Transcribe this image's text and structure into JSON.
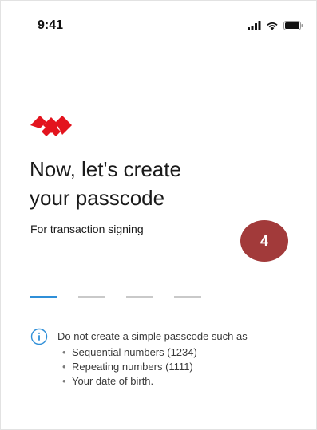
{
  "status_bar": {
    "time": "9:41"
  },
  "icons": {
    "signal": "cellular-signal-icon",
    "wifi": "wifi-icon",
    "battery": "battery-icon",
    "logo": "brand-diamond-logo",
    "info": "info-icon"
  },
  "colors": {
    "brand_red": "#e3141e",
    "accent_blue": "#2f8fd8",
    "badge": "#a23a3a"
  },
  "header": {
    "title_line1": "Now, let's create",
    "title_line2": "your passcode",
    "subtitle": "For transaction signing"
  },
  "step_badge": {
    "number": "4"
  },
  "passcode": {
    "length": 4,
    "entered": 0
  },
  "info": {
    "text": "Do not create a simple passcode such as",
    "items": [
      "Sequential numbers (1234)",
      "Repeating numbers (1111)",
      "Your date of birth."
    ]
  }
}
